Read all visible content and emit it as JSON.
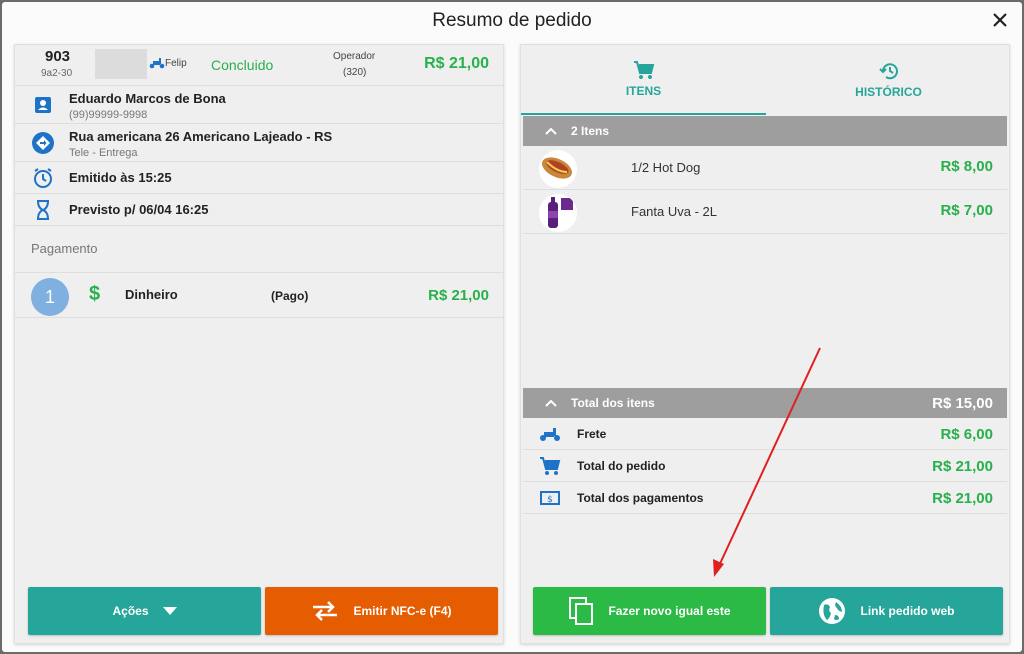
{
  "modal": {
    "title": "Resumo de pedido"
  },
  "order": {
    "number": "903",
    "code": "9a2-30",
    "delivery_tag": "Felipe",
    "status": "Concluido",
    "operator_label": "Operador",
    "operator_code": "(320)",
    "total": "R$ 21,00"
  },
  "customer": {
    "name": "Eduardo Marcos de Bona",
    "phone": "(99)99999-9998"
  },
  "address": {
    "line": "Rua americana 26 Americano Lajeado - RS",
    "type": "Tele - Entrega"
  },
  "issued": {
    "text": "Emitido às 15:25"
  },
  "expected": {
    "text": "Previsto p/ 06/04 16:25"
  },
  "payment": {
    "section_label": "Pagamento",
    "index": "1",
    "symbol": "$",
    "method": "Dinheiro",
    "state": "(Pago)",
    "amount": "R$ 21,00"
  },
  "left_actions": {
    "actions_label": "Ações",
    "nfce_label": "Emitir NFC-e (F4)"
  },
  "tabs": {
    "items_label": "ITENS",
    "history_label": "HISTÓRICO"
  },
  "items_section": {
    "header": "2 Itens",
    "items": [
      {
        "name": "1/2 Hot Dog",
        "price": "R$ 8,00"
      },
      {
        "name": "Fanta Uva - 2L",
        "price": "R$ 7,00"
      }
    ]
  },
  "totals": {
    "header_label": "Total dos itens",
    "header_value": "R$ 15,00",
    "rows": [
      {
        "label": "Frete",
        "value": "R$ 6,00"
      },
      {
        "label": "Total do pedido",
        "value": "R$ 21,00"
      },
      {
        "label": "Total dos pagamentos",
        "value": "R$ 21,00"
      }
    ]
  },
  "right_actions": {
    "new_order_label": "Fazer novo igual este",
    "web_link_label": "Link pedido web"
  },
  "colors": {
    "accent_teal": "#26a69a",
    "green": "#28b04c",
    "orange": "#e65c00",
    "blue": "#1e73c8",
    "red_arrow": "#e02020"
  }
}
